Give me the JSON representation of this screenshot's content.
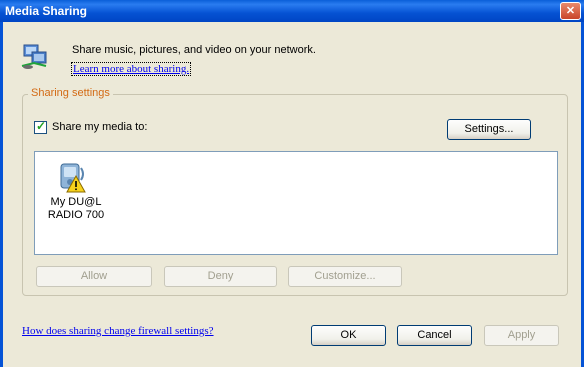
{
  "window": {
    "title": "Media Sharing",
    "close_label": "✕"
  },
  "header": {
    "description": "Share music, pictures, and video on your network.",
    "learn_link": "Learn more about sharing."
  },
  "sharing_settings": {
    "group_label": "Sharing settings",
    "share_checkbox_checked": true,
    "share_label": "Share my media to:",
    "settings_button": "Settings..."
  },
  "devices": [
    {
      "name_line1": "My DU@L",
      "name_line2": "RADIO 700",
      "status": "warning"
    }
  ],
  "device_actions": {
    "allow": "Allow",
    "deny": "Deny",
    "customize": "Customize..."
  },
  "footer": {
    "firewall_link": "How does sharing change firewall settings?",
    "ok": "OK",
    "cancel": "Cancel",
    "apply": "Apply"
  },
  "colors": {
    "titlebar": "#0552d3",
    "group_label": "#d36a14",
    "link": "#0000ee"
  }
}
